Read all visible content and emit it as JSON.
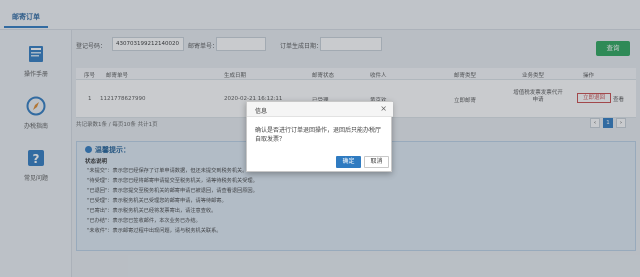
{
  "header": {
    "active_tab": "邮寄订单"
  },
  "sidebar": {
    "items": [
      {
        "label": "操作手册",
        "icon": "book-icon"
      },
      {
        "label": "办税指南",
        "icon": "compass-icon"
      },
      {
        "label": "常见问题",
        "icon": "question-icon"
      }
    ]
  },
  "filters": {
    "order_no_label": "登记号码：",
    "order_no_value": "430703199212140020",
    "mail_no_label": "邮寄单号：",
    "mail_no_value": "",
    "date_label": "订单生成日期：",
    "date_value": "",
    "query_label": "查询"
  },
  "table": {
    "headers": [
      "序号",
      "邮寄单号",
      "生成日期",
      "邮寄状态",
      "收件人",
      "邮寄类型",
      "业务类型",
      "操作"
    ],
    "rows": [
      {
        "index": "1",
        "mail_no": "1121778627990",
        "date": "2020-02-21 16:12:11",
        "status": "已受理",
        "recipient": "黄京欢",
        "type": "立即邮寄",
        "business_l1": "增值税发票发票代开",
        "business_l2": "申请",
        "action_cancel": "立即退回",
        "action_detail": "查看"
      }
    ]
  },
  "pager": {
    "summary": "共记录数1条 / 每页10条 共计1页",
    "current": "1"
  },
  "notice": {
    "title": "温馨提示：",
    "subtitle": "状态说明",
    "lines": [
      "\"未提交\"：表示您已经保存了订单申请数据，但还未提交到税务机关。",
      "\"待受理\"：表示您已经将邮寄申请提交至税务机关，请等待税务机关受理。",
      "\"已退回\"：表示您提交至税务机关的邮寄申请已被退回，请查看退回原因。",
      "\"已受理\"：表示税务机关已受理您的邮寄申请，请等待邮寄。",
      "\"已寄出\"：表示税务机关已经将发票寄出，请注意查收。",
      "\"已办结\"：表示您已签收邮件，本次业务已办结。",
      "\"未收件\"：表示邮寄过程中出现问题，请与税务机关联系。"
    ]
  },
  "modal": {
    "title": "信息",
    "message": "确认是否进行订单退回操作，退回后只能办税厅自取发票？",
    "ok_label": "确定",
    "cancel_label": "取消"
  },
  "colors": {
    "accent": "#2f7bc1",
    "query": "#2aa65a",
    "danger": "#c94a4a"
  }
}
